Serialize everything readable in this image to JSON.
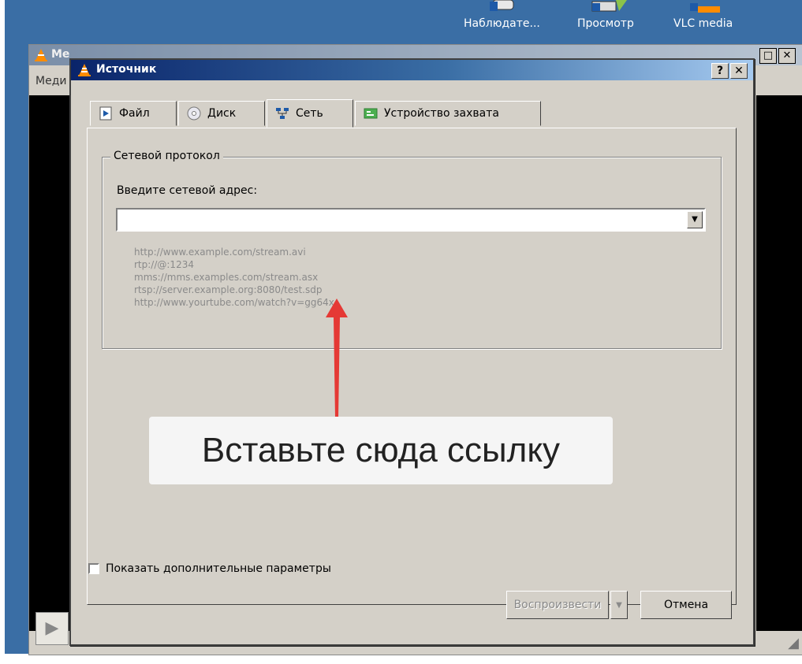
{
  "desktop": {
    "icons": [
      {
        "label": "Наблюдате..."
      },
      {
        "label": "Просмотр"
      },
      {
        "label": "VLC media"
      }
    ]
  },
  "background_window": {
    "title": "Ме",
    "menu": "Меди",
    "time_left": "--:--",
    "time_right": "--:--"
  },
  "dialog": {
    "title": "Источник",
    "help_button": "?",
    "close_button": "✕",
    "tabs": [
      {
        "label": "Файл",
        "icon": "file-play-icon"
      },
      {
        "label": "Диск",
        "icon": "disc-icon"
      },
      {
        "label": "Сеть",
        "icon": "network-icon",
        "active": true
      },
      {
        "label": "Устройство захвата",
        "icon": "capture-card-icon"
      }
    ],
    "group_title": "Сетевой протокол",
    "address_label": "Введите сетевой адрес:",
    "address_value": "",
    "examples": [
      "http://www.example.com/stream.avi",
      "rtp://@:1234",
      "mms://mms.examples.com/stream.asx",
      "rtsp://server.example.org:8080/test.sdp",
      "http://www.yourtube.com/watch?v=gg64x"
    ],
    "annotation_text": "Вставьте сюда ссылку",
    "show_more_label": "Показать дополнительные параметры",
    "play_button": "Воспроизвести",
    "cancel_button": "Отмена"
  },
  "colors": {
    "desktop": "#3a6ea5",
    "dialog_face": "#d4d0c8",
    "titlebar_start": "#0a246a",
    "titlebar_end": "#a6caf0",
    "annotation_arrow": "#e53935"
  }
}
